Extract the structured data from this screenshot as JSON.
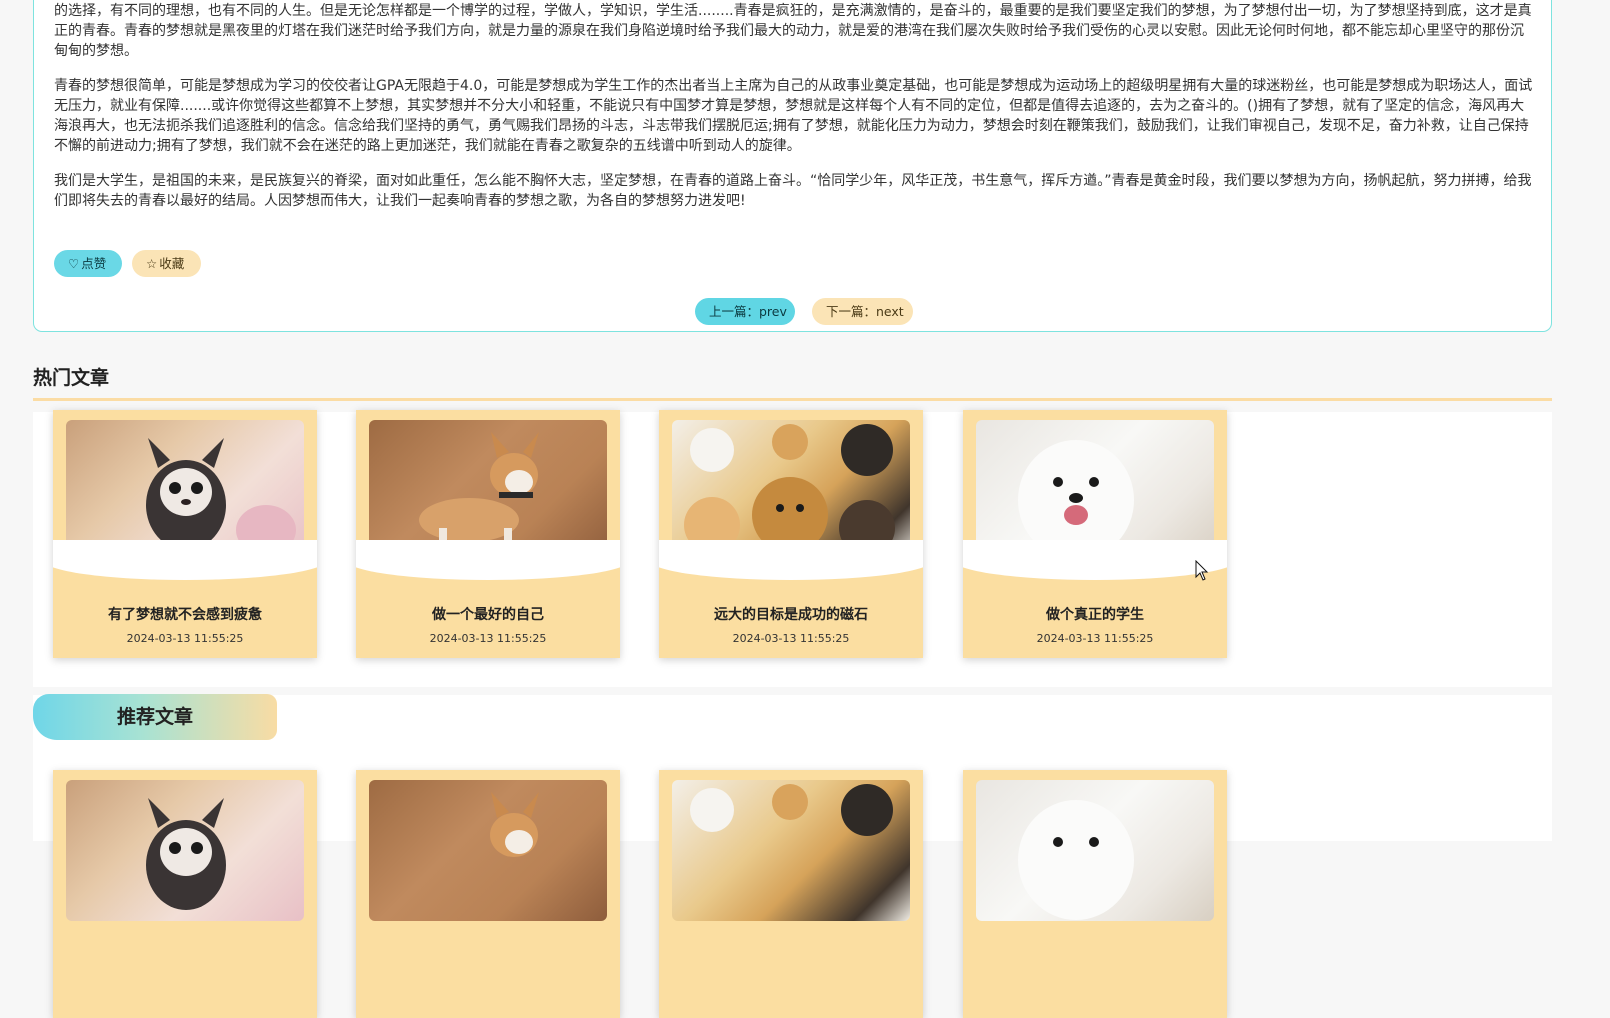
{
  "article": {
    "paragraphs": [
      "的选择，有不同的理想，也有不同的人生。但是无论怎样都是一个博学的过程，学做人，学知识，学生活........青春是疯狂的，是充满激情的，是奋斗的，最重要的是我们要坚定我们的梦想，为了梦想付出一切，为了梦想坚持到底，这才是真正的青春。青春的梦想就是黑夜里的灯塔在我们迷茫时给予我们方向，就是力量的源泉在我们身陷逆境时给予我们最大的动力，就是爱的港湾在我们屡次失败时给予我们受伤的心灵以安慰。因此无论何时何地，都不能忘却心里坚守的那份沉甸甸的梦想。",
      "青春的梦想很简单，可能是梦想成为学习的佼佼者让GPA无限趋于4.0，可能是梦想成为学生工作的杰出者当上主席为自己的从政事业奠定基础，也可能是梦想成为运动场上的超级明星拥有大量的球迷粉丝，也可能是梦想成为职场达人，面试无压力，就业有保障.......或许你觉得这些都算不上梦想，其实梦想并不分大小和轻重，不能说只有中国梦才算是梦想，梦想就是这样每个人有不同的定位，但都是值得去追逐的，去为之奋斗的。()拥有了梦想，就有了坚定的信念，海风再大海浪再大，也无法扼杀我们追逐胜利的信念。信念给我们坚持的勇气，勇气赐我们昂扬的斗志，斗志带我们摆脱厄运;拥有了梦想，就能化压力为动力，梦想会时刻在鞭策我们，鼓励我们，让我们审视自己，发现不足，奋力补救，让自己保持不懈的前进动力;拥有了梦想，我们就不会在迷茫的路上更加迷茫，我们就能在青春之歌复杂的五线谱中听到动人的旋律。",
      "我们是大学生，是祖国的未来，是民族复兴的脊梁，面对如此重任，怎么能不胸怀大志，坚定梦想，在青春的道路上奋斗。“恰同学少年，风华正茂，书生意气，挥斥方遒。”青春是黄金时段，我们要以梦想为方向，扬帆起航，努力拼搏，给我们即将失去的青春以最好的结局。人因梦想而伟大，让我们一起奏响青春的梦想之歌，为各自的梦想努力进发吧!"
    ],
    "like_icon": "heart-icon",
    "like_label": "点赞",
    "fav_icon": "star-icon",
    "fav_label": "收藏",
    "prev_label": "上一篇：prev",
    "next_label": "下一篇：next"
  },
  "hot": {
    "title": "热门文章",
    "cards": [
      {
        "title": "有了梦想就不会感到疲惫",
        "date": "2024-03-13 11:55:25",
        "image": "chihuahua-photo"
      },
      {
        "title": "做一个最好的自己",
        "date": "2024-03-13 11:55:25",
        "image": "shiba-dog-photo"
      },
      {
        "title": "远大的目标是成功的磁石",
        "date": "2024-03-13 11:55:25",
        "image": "cats-dogs-collage-photo"
      },
      {
        "title": "做个真正的学生",
        "date": "2024-03-13 11:55:25",
        "image": "samoyed-photo"
      }
    ]
  },
  "recommend": {
    "title": "推荐文章"
  },
  "colors": {
    "accent_cyan": "#60d6e4",
    "accent_peach": "#fbdea1",
    "card_border": "#7ee3df"
  }
}
